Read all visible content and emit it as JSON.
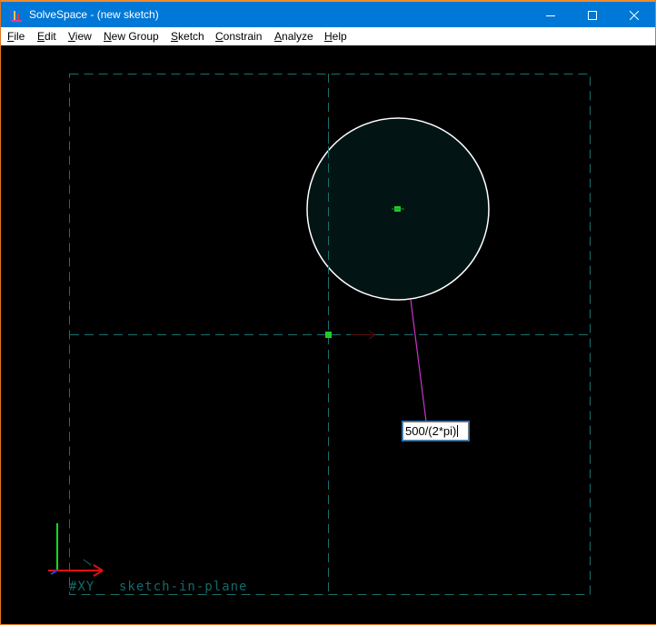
{
  "window": {
    "title": "SolveSpace - (new sketch)",
    "app_icon": "solvespace-app-icon",
    "controls": [
      "minimize-icon",
      "maximize-icon",
      "close-icon"
    ]
  },
  "menubar": {
    "items": [
      {
        "label": "File",
        "mnemonic": "F",
        "rest": "ile"
      },
      {
        "label": "Edit",
        "mnemonic": "E",
        "rest": "dit"
      },
      {
        "label": "View",
        "mnemonic": "V",
        "rest": "iew"
      },
      {
        "label": "New Group",
        "mnemonic": "N",
        "rest": "ew Group"
      },
      {
        "label": "Sketch",
        "mnemonic": "S",
        "rest": "ketch"
      },
      {
        "label": "Constrain",
        "mnemonic": "C",
        "rest": "onstrain"
      },
      {
        "label": "Analyze",
        "mnemonic": "A",
        "rest": "nalyze"
      },
      {
        "label": "Help",
        "mnemonic": "H",
        "rest": "elp"
      }
    ]
  },
  "sketch": {
    "dimension_input_value": "500/(2*pi)",
    "workplane_label": "#XY",
    "workplane_mode": "sketch-in-plane",
    "colors": {
      "background": "#000000",
      "workplane_dashed": "#1a6f6f",
      "circle_stroke": "#ffffff",
      "circle_fill": "#031414",
      "point": "#22cc22",
      "leader_line": "#cc33cc",
      "axis_x": "#dd1111",
      "axis_y": "#11dd11",
      "axis_z": "#1a6f6f",
      "titlebar": "#0078d7",
      "window_border": "#e0781f"
    }
  }
}
